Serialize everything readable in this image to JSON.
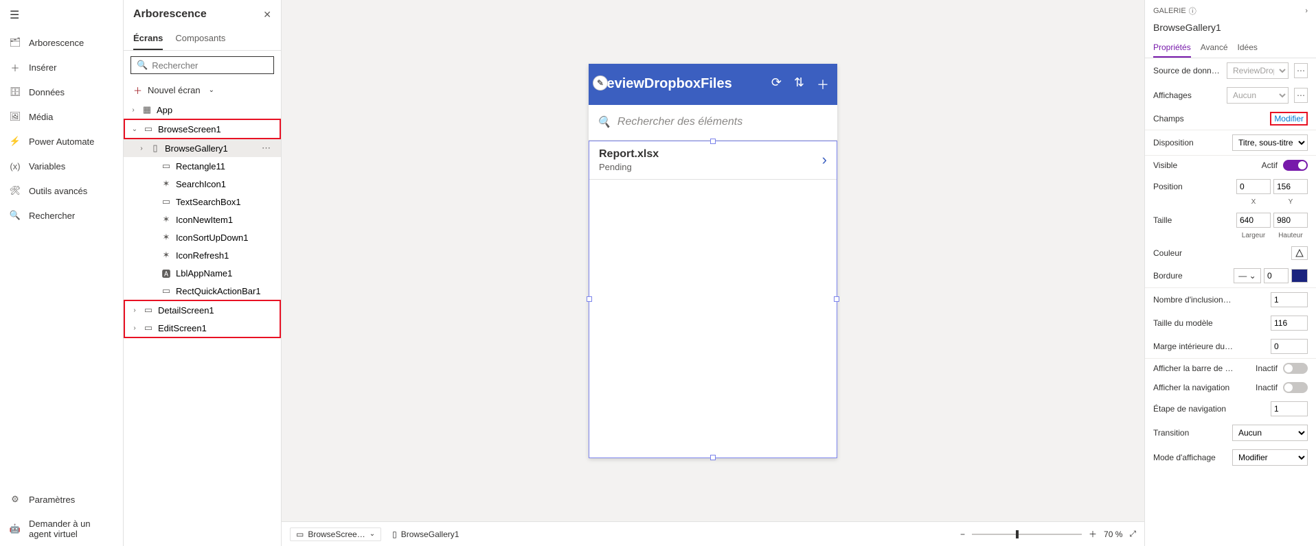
{
  "leftnav": {
    "items": [
      {
        "label": "Arborescence"
      },
      {
        "label": "Insérer"
      },
      {
        "label": "Données"
      },
      {
        "label": "Média"
      },
      {
        "label": "Power Automate"
      },
      {
        "label": "Variables"
      },
      {
        "label": "Outils avancés"
      },
      {
        "label": "Rechercher"
      }
    ],
    "bottom": [
      {
        "label": "Paramètres"
      },
      {
        "label": "Demander à un agent virtuel"
      }
    ]
  },
  "tree": {
    "title": "Arborescence",
    "tabs": {
      "screens": "Écrans",
      "components": "Composants"
    },
    "search_placeholder": "Rechercher",
    "new_screen": "Nouvel écran",
    "nodes": {
      "app": "App",
      "browse_screen": "BrowseScreen1",
      "browse_gallery": "BrowseGallery1",
      "rectangle": "Rectangle11",
      "search_icon": "SearchIcon1",
      "text_search": "TextSearchBox1",
      "icon_new": "IconNewItem1",
      "icon_sort": "IconSortUpDown1",
      "icon_refresh": "IconRefresh1",
      "lbl_app": "LblAppName1",
      "rect_quick": "RectQuickActionBar1",
      "detail_screen": "DetailScreen1",
      "edit_screen": "EditScreen1"
    }
  },
  "canvas": {
    "app_title": "ReviewDropboxFiles",
    "search_placeholder": "Rechercher des éléments",
    "item": {
      "title": "Report.xlsx",
      "subtitle": "Pending"
    }
  },
  "statusbar": {
    "breadcrumb_screen": "BrowseScree…",
    "breadcrumb_control": "BrowseGallery1",
    "zoom": "70  %"
  },
  "props": {
    "crumb": "GALERIE",
    "selected_name": "BrowseGallery1",
    "tabs": {
      "properties": "Propriétés",
      "advanced": "Avancé",
      "ideas": "Idées"
    },
    "labels": {
      "datasource": "Source de données",
      "views": "Affichages",
      "fields": "Champs",
      "fields_edit": "Modifier",
      "layout": "Disposition",
      "visible": "Visible",
      "visible_val": "Actif",
      "position": "Position",
      "x": "X",
      "y": "Y",
      "size": "Taille",
      "width": "Largeur",
      "height": "Hauteur",
      "color": "Couleur",
      "border": "Bordure",
      "wrapcount": "Nombre d'inclusion…",
      "template_size": "Taille du modèle",
      "template_padding": "Marge intérieure du…",
      "show_scrollbar": "Afficher la barre de …",
      "show_nav": "Afficher la navigation",
      "nav_step": "Étape de navigation",
      "transition": "Transition",
      "display_mode": "Mode d'affichage",
      "inactive": "Inactif"
    },
    "values": {
      "datasource": "ReviewDropbo…",
      "views": "Aucun",
      "layout": "Titre, sous-titre et corps",
      "pos_x": "0",
      "pos_y": "156",
      "size_w": "640",
      "size_h": "980",
      "border_w": "0",
      "wrapcount": "1",
      "template_size": "116",
      "template_padding": "0",
      "nav_step": "1",
      "transition": "Aucun",
      "display_mode": "Modifier"
    }
  }
}
